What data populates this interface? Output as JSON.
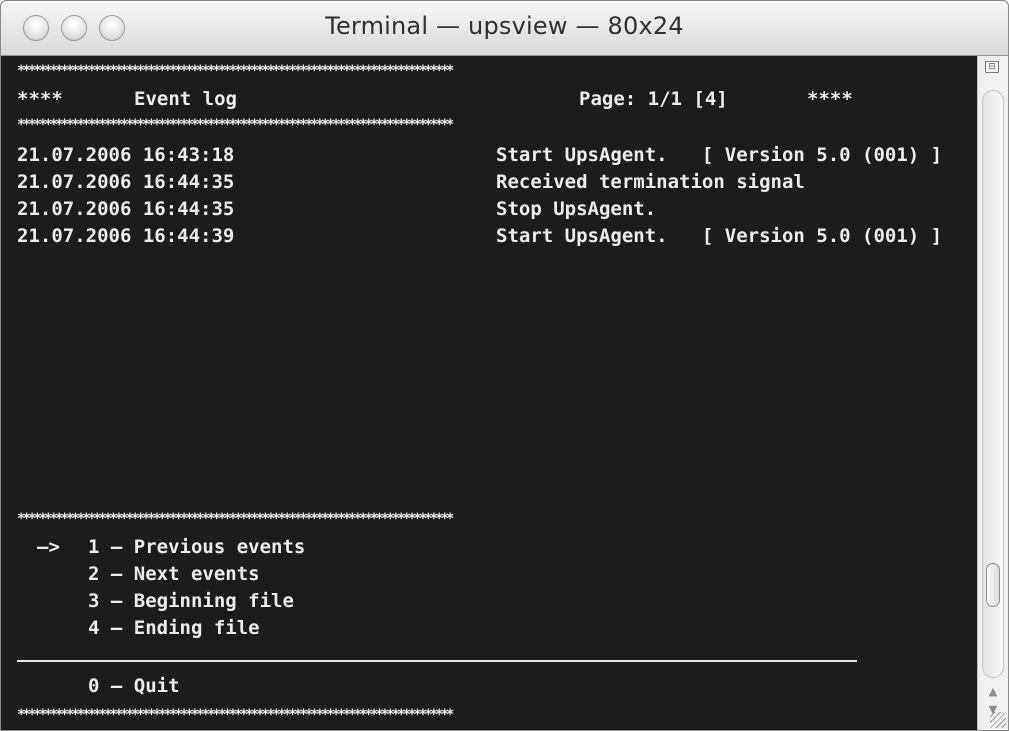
{
  "window": {
    "title": "Terminal — upsview — 80x24"
  },
  "terminal": {
    "star_row": "********************************************************************************",
    "header": {
      "left_stars": "****",
      "title": "Event log",
      "page": "Page: 1/1 [4]",
      "right_stars": "****"
    },
    "events": [
      {
        "timestamp": "21.07.2006 16:43:18",
        "message": "Start UpsAgent.   [ Version 5.0 (001) ]"
      },
      {
        "timestamp": "21.07.2006 16:44:35",
        "message": "Received termination signal"
      },
      {
        "timestamp": "21.07.2006 16:44:35",
        "message": "Stop UpsAgent."
      },
      {
        "timestamp": "21.07.2006 16:44:39",
        "message": "Start UpsAgent.   [ Version 5.0 (001) ]"
      }
    ],
    "menu": {
      "pointer": "—>",
      "items": [
        {
          "key": "1",
          "label": "1 – Previous events"
        },
        {
          "key": "2",
          "label": "2 – Next events"
        },
        {
          "key": "3",
          "label": "3 – Beginning file"
        },
        {
          "key": "4",
          "label": "4 – Ending file"
        }
      ],
      "quit": "0 – Quit"
    }
  },
  "icons": {
    "scroll_up": "arrow-up-icon",
    "scroll_down": "arrow-down-icon",
    "split": "split-pane-icon",
    "resize": "resize-grip-icon"
  },
  "colors": {
    "terminal_bg": "#1c1c1c",
    "terminal_fg": "#ececec"
  }
}
